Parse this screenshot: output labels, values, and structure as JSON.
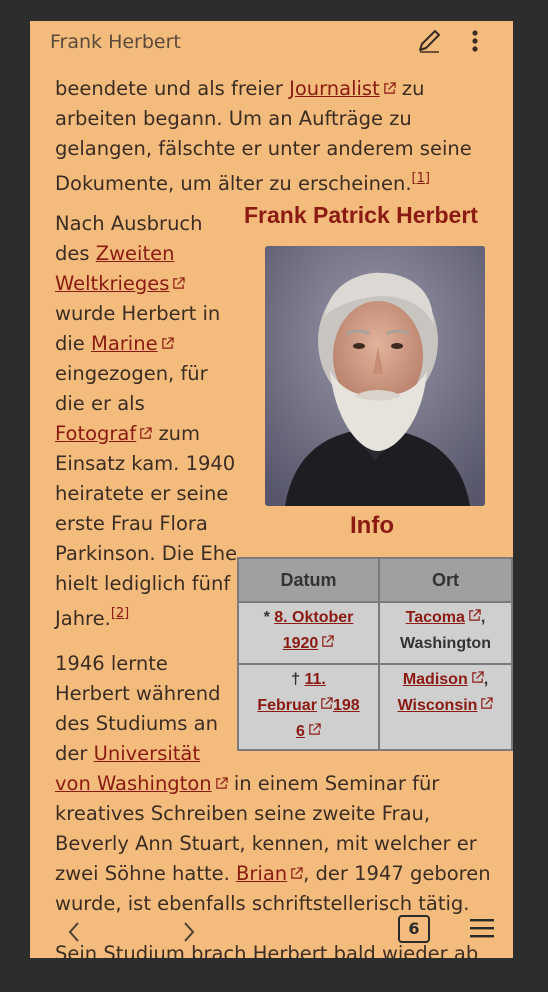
{
  "header": {
    "title": "Frank Herbert",
    "edit_icon": "pencil-icon",
    "more_icon": "more-vertical-icon"
  },
  "article": {
    "p1": {
      "line1_pre": "beendete und als freier ",
      "link_journalist": "Journalist",
      "line1_post": " zu",
      "line2": "arbeiten begann. Um an Aufträge zu",
      "line3": "gelangen, fälschte er unter anderem seine",
      "line4": "Dokumente, um älter zu erscheinen.",
      "ref": "[1]"
    },
    "p2": {
      "t1": "Nach Ausbruch",
      "t2": "des ",
      "link_zweiten": "Zweiten",
      "link_weltkrieges": "Weltkrieges",
      "t3": "wurde Herbert in",
      "t4": "die ",
      "link_marine": "Marine",
      "t5": "eingezogen, für",
      "t6": "die er als",
      "link_fotograf": "Fotograf",
      "t7": " zum",
      "t8": "Einsatz kam. 1940",
      "t9": "heiratete er seine",
      "t10": "erste Frau Flora",
      "t11": "Parkinson. Die Ehe",
      "t12": "hielt lediglich fünf",
      "t13": "Jahre.",
      "ref": "[2]"
    },
    "p3": {
      "t1": "1946 lernte",
      "t2": "Herbert während",
      "t3": "des Studiums an",
      "t4": "der ",
      "link_uni1": "Universität",
      "link_uni2": "von Washington",
      "t5": " in einem Seminar für",
      "t6": "kreatives Schreiben seine zweite Frau,",
      "t7": "Beverly Ann Stuart, kennen, mit welcher er",
      "t8": "zwei Söhne hatte. ",
      "link_brian": "Brian",
      "t9": ", der 1947 geboren",
      "t10": "wurde, ist ebenfalls schriftstellerisch tätig."
    },
    "p4": {
      "t1": "Sein Studium brach Herbert bald wieder ab"
    }
  },
  "infobox": {
    "title": "Frank Patrick Herbert",
    "section": "Info",
    "columns": [
      "Datum",
      "Ort"
    ],
    "birth": {
      "symbol": "* ",
      "date_a": "8. Oktober",
      "date_b": "1920",
      "place_link": "Tacoma",
      "place_sep": ",",
      "place_rest": "Washington"
    },
    "death": {
      "symbol": "† ",
      "date_a": "11.",
      "date_b": "Februar",
      "date_c": "198",
      "date_d": "6",
      "place_link": "Madison",
      "place_sep": ",",
      "place_link2": "Wisconsin"
    }
  },
  "footer": {
    "back_icon": "chevron-left-icon",
    "forward_icon": "chevron-right-icon",
    "tab_count": "6",
    "menu_icon": "hamburger-menu-icon"
  }
}
